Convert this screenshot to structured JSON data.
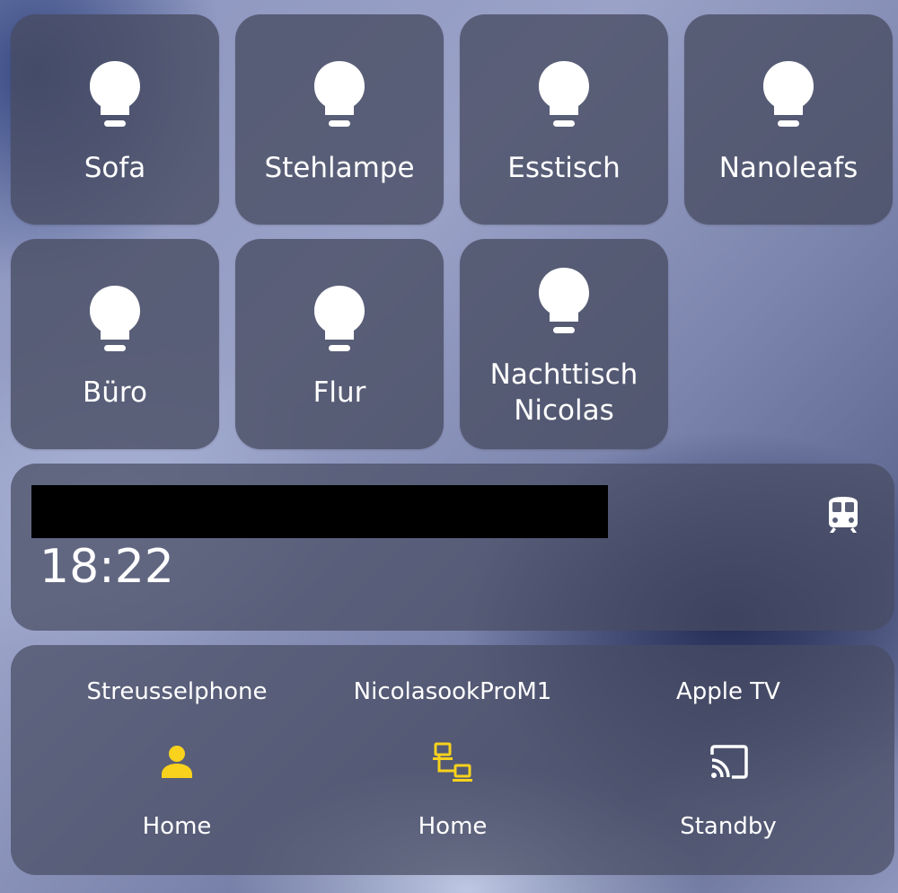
{
  "lights": [
    {
      "label": "Sofa",
      "icon": "lightbulb-icon"
    },
    {
      "label": "Stehlampe",
      "icon": "lightbulb-icon"
    },
    {
      "label": "Esstisch",
      "icon": "lightbulb-icon"
    },
    {
      "label": "Nanoleafs",
      "icon": "lightbulb-icon"
    },
    {
      "label": "Büro",
      "icon": "lightbulb-icon"
    },
    {
      "label": "Flur",
      "icon": "lightbulb-icon"
    },
    {
      "label_line1": "Nachttisch",
      "label_line2": "Nicolas",
      "icon": "lightbulb-icon"
    }
  ],
  "transit": {
    "time": "18:22",
    "icon": "train-icon"
  },
  "devices": [
    {
      "name": "Streusselphone",
      "state": "Home",
      "icon": "person-icon",
      "icon_color": "#F8D21C"
    },
    {
      "name": "NicolasookProM1",
      "state": "Home",
      "icon": "lan-network-icon",
      "icon_color": "#F8D21C"
    },
    {
      "name": "Apple TV",
      "state": "Standby",
      "icon": "cast-icon",
      "icon_color": "#FFFFFF"
    }
  ]
}
